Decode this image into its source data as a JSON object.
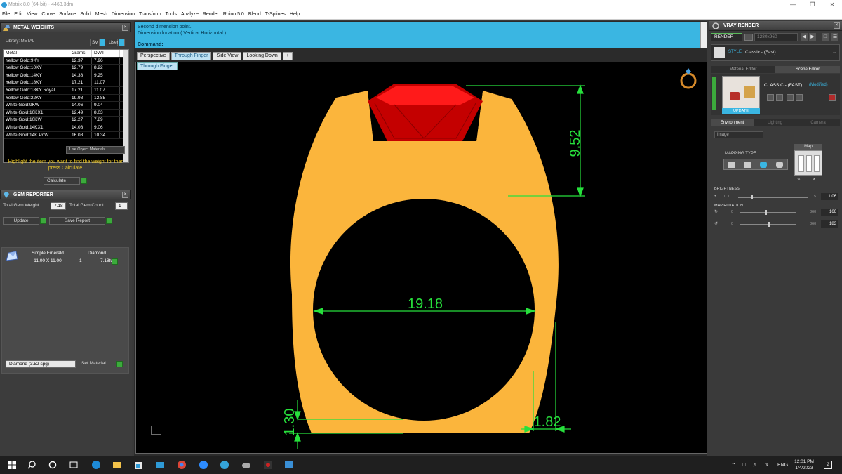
{
  "window": {
    "title": "Matrix 8.0 (64-bit) - 4463.3dm"
  },
  "menu": [
    "File",
    "Edit",
    "View",
    "Curve",
    "Surface",
    "Solid",
    "Mesh",
    "Dimension",
    "Transform",
    "Tools",
    "Analyze",
    "Render",
    "Rhino 5.0",
    "Blend",
    "T-Splines",
    "Help"
  ],
  "metal_weights": {
    "title": "METAL WEIGHTS",
    "library_label": "Library: METAL",
    "sv_label": "SV",
    "user_label": "User",
    "headers": [
      "Metal",
      "Grams",
      "DWT"
    ],
    "rows": [
      [
        "Yellow Gold:9KY",
        "12.37",
        "7.96"
      ],
      [
        "Yellow Gold:10KY",
        "12.79",
        "8.22"
      ],
      [
        "Yellow Gold:14KY",
        "14.38",
        "9.25"
      ],
      [
        "Yellow Gold:18KY",
        "17.21",
        "11.07"
      ],
      [
        "Yellow Gold:18KY Royal",
        "17.21",
        "11.07"
      ],
      [
        "Yellow Gold:22KY",
        "19.98",
        "12.85"
      ],
      [
        "White Gold:9KW",
        "14.06",
        "9.04"
      ],
      [
        "White Gold:10KX1",
        "12.49",
        "8.03"
      ],
      [
        "White Gold:10KW",
        "12.27",
        "7.89"
      ],
      [
        "White Gold:14KX1",
        "14.08",
        "9.06"
      ],
      [
        "White Gold:14K PdW",
        "16.08",
        "10.34"
      ]
    ],
    "use_object_materials": "Use Object Materials",
    "hint": "Highlight the item you want to find the weight for then press Calculate.",
    "calculate": "Calculate"
  },
  "gem_reporter": {
    "title": "GEM REPORTER",
    "total_weight_label": "Total Gem Weight",
    "total_weight_value": "7.18",
    "total_count_label": "Total Gem Count",
    "total_count_value": "1",
    "update": "Update",
    "save_report": "Save Report",
    "gem": {
      "cut": "Simple Emerald",
      "size": "11.00 X 11.00",
      "material": "Diamond",
      "count": "1",
      "weight": "7.18tw"
    },
    "material_select": "Diamond    (3.52 spg)",
    "set_material": "Set Material"
  },
  "command": {
    "line1": "Second dimension point.",
    "line2": "Dimension location ( Vertical  Horizontal )",
    "prompt": "Command:"
  },
  "viewport_tabs": [
    "Perspective",
    "Through Finger",
    "Side View",
    "Looking Down",
    "+"
  ],
  "active_view": "Through Finger",
  "dimensions": {
    "top_height": "9.52",
    "inner_diameter": "19.18",
    "bottom_thickness": "1.30",
    "side_thickness": "1.82"
  },
  "colors": {
    "metal": "#fbb53c",
    "gem": "#d40000",
    "dimension": "#27e03c",
    "command_bg": "#3ab6e2"
  },
  "vray": {
    "title": "VRAY RENDER",
    "render": "RENDER",
    "resolution": "1280x960",
    "style_label": "STYLE",
    "style_value": "Classic - (Fast)",
    "tabs": [
      "Material Editor",
      "Scene Editor"
    ],
    "preset": "CLASSIC - (FAST)",
    "modified": "(Modified)",
    "update": "UPDATE",
    "env_tabs": [
      "Environment",
      "Lighting",
      "Camera"
    ],
    "env_select": "Image",
    "mapping_type": "MAPPING TYPE",
    "map_label": "Map",
    "brightness_label": "BRIGHTNESS",
    "brightness_min": "0.1",
    "brightness_max": "5",
    "brightness_value": "1.06",
    "map_rotation_label": "MAP ROTATION",
    "rot1_min": "0",
    "rot1_max": "360",
    "rot1_value": "166",
    "rot2_min": "0",
    "rot2_max": "360",
    "rot2_value": "183"
  },
  "taskbar": {
    "lang": "ENG",
    "time": "12:01 PM",
    "date": "1/4/2023",
    "notifications": "2"
  }
}
